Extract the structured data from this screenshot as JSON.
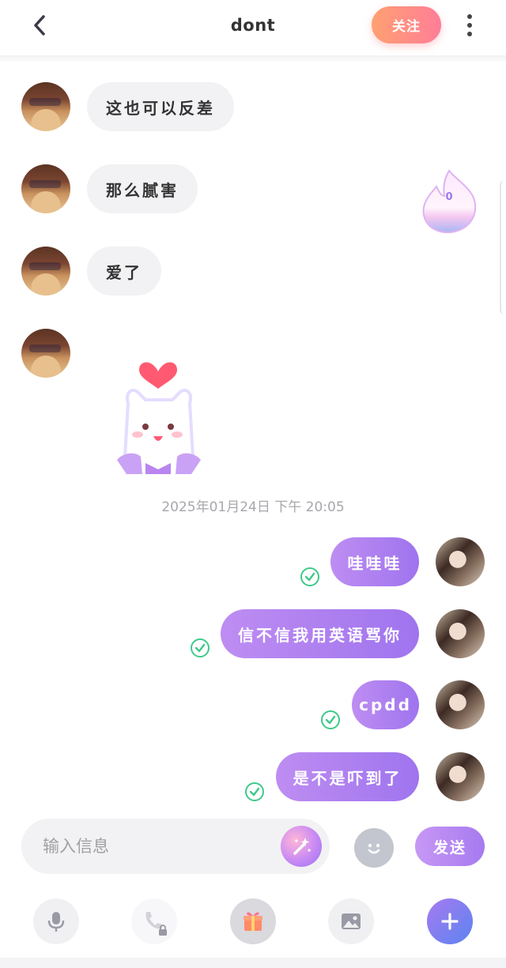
{
  "header": {
    "title": "dont",
    "follow_label": "关注"
  },
  "messages_in": [
    {
      "text": "这也可以反差"
    },
    {
      "text": "那么腻害"
    },
    {
      "text": "爱了"
    }
  ],
  "flame_widget": {
    "count": "0"
  },
  "timestamp": "2025年01月24日 下午 20:05",
  "messages_out": [
    {
      "text": "哇哇哇",
      "status": "read"
    },
    {
      "text": "信不信我用英语骂你",
      "status": "read"
    },
    {
      "text": "cpdd",
      "status": "read"
    },
    {
      "text": "是不是吓到了",
      "status": "read"
    }
  ],
  "composer": {
    "placeholder": "输入信息",
    "send_label": "发送"
  },
  "toolbar": {
    "items": [
      "mic-icon",
      "phone-locked-icon",
      "gift-icon",
      "image-icon",
      "plus-icon"
    ]
  },
  "colors": {
    "follow_gradient": [
      "#ffa070",
      "#ff7e98"
    ],
    "bubble_out": [
      "#be8df2",
      "#9f74ee"
    ],
    "check": "#3fc98a",
    "plus_button": [
      "#a67af0",
      "#5c84f0"
    ]
  }
}
